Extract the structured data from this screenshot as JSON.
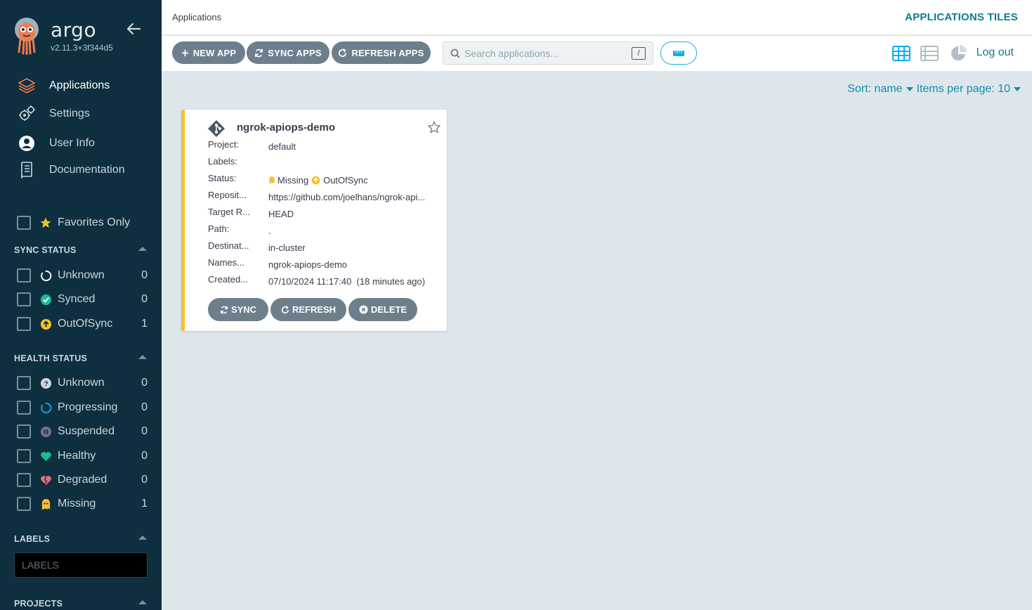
{
  "brand": {
    "name": "argo",
    "version": "v2.11.3+3f344d5"
  },
  "nav": [
    {
      "label": "Applications",
      "icon": "layers-icon"
    },
    {
      "label": "Settings",
      "icon": "gears-icon"
    },
    {
      "label": "User Info",
      "icon": "user-circle-icon"
    },
    {
      "label": "Documentation",
      "icon": "book-icon"
    }
  ],
  "favorites_label": "Favorites Only",
  "sync_status": {
    "title": "SYNC STATUS",
    "items": [
      {
        "label": "Unknown",
        "count": "0"
      },
      {
        "label": "Synced",
        "count": "0"
      },
      {
        "label": "OutOfSync",
        "count": "1"
      }
    ]
  },
  "health_status": {
    "title": "HEALTH STATUS",
    "items": [
      {
        "label": "Unknown",
        "count": "0"
      },
      {
        "label": "Progressing",
        "count": "0"
      },
      {
        "label": "Suspended",
        "count": "0"
      },
      {
        "label": "Healthy",
        "count": "0"
      },
      {
        "label": "Degraded",
        "count": "0"
      },
      {
        "label": "Missing",
        "count": "1"
      }
    ]
  },
  "labels_section": {
    "title": "LABELS",
    "placeholder": "LABELS"
  },
  "projects_section": {
    "title": "PROJECTS"
  },
  "header": {
    "breadcrumb": "Applications",
    "title": "APPLICATIONS TILES"
  },
  "toolbar": {
    "new_app": "NEW APP",
    "sync_apps": "SYNC APPS",
    "refresh_apps": "REFRESH APPS",
    "search_placeholder": "Search applications...",
    "search_shortcut": "/",
    "logout": "Log out"
  },
  "sort": {
    "label": "Sort: name",
    "per_page": "Items per page: 10"
  },
  "app": {
    "name": "ngrok-apiops-demo",
    "fields": [
      {
        "key": "Project:",
        "value": "default"
      },
      {
        "key": "Labels:",
        "value": ""
      },
      {
        "key": "Status:",
        "value": ""
      },
      {
        "key": "Reposit...",
        "value": "https://github.com/joelhans/ngrok-api..."
      },
      {
        "key": "Target R...",
        "value": "HEAD"
      },
      {
        "key": "Path:",
        "value": "."
      },
      {
        "key": "Destinat...",
        "value": "in-cluster"
      },
      {
        "key": "Names...",
        "value": "ngrok-apiops-demo"
      },
      {
        "key": "Created...",
        "value": "07/10/2024 11:17:40  (18 minutes ago)"
      }
    ],
    "health": "Missing",
    "sync": "OutOfSync",
    "actions": {
      "sync": "SYNC",
      "refresh": "REFRESH",
      "delete": "DELETE"
    }
  },
  "colors": {
    "sidebar_bg": "#0d2f3f",
    "accent": "#0f7b8e",
    "button_bg": "#6d7f8b",
    "missing": "#f4c030",
    "synced": "#18be94",
    "progressing": "#0dadea",
    "suspended": "#766f94",
    "degraded": "#e96d76"
  }
}
